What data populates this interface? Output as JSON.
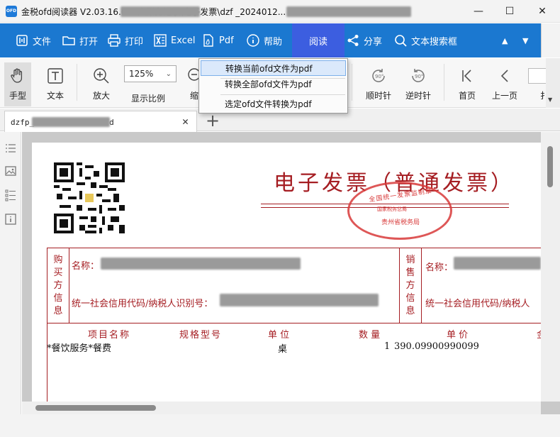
{
  "window": {
    "app_icon_text": "OFD",
    "title": "金税ofd阅读器 V2.03.16.06-                            人账务记录\\电子发票\\dzf                              _2024012...",
    "minimize": "—",
    "maximize": "☐",
    "close": "✕"
  },
  "toolbar": {
    "file": "文件",
    "open": "打开",
    "print": "打印",
    "excel": "Excel",
    "pdf": "Pdf",
    "help": "帮助",
    "read": "阅读",
    "share": "分享",
    "search": "文本搜索框",
    "up_arrow": "▲",
    "down_arrow": "▼"
  },
  "toolbar2": {
    "hand": "手型",
    "text": "文本",
    "zoom_in": "放大",
    "zoom_value": "125%",
    "zoom_label": "显示比例",
    "zoom_out": "缩",
    "rotate_cw": "顺时针",
    "rotate_ccw": "逆时针",
    "first_page": "首页",
    "prev_page": "上一页",
    "clipped_label": "扌"
  },
  "pdf_menu": {
    "items": [
      "转换当前ofd文件为pdf",
      "转换全部ofd文件为pdf",
      "选定ofd文件转换为pdf"
    ]
  },
  "doc_tab": {
    "name": "dzfp_                240129104546.ofd",
    "close": "✕",
    "new_tab": "+"
  },
  "invoice": {
    "title": "电子发票（普通发票）",
    "seal_top": "全国统一发票监制章",
    "seal_mid": "国家税务总局",
    "seal_bottom": "贵州省税务局",
    "buyer_label": "购买方信息",
    "seller_label": "销售方信息",
    "name_label": "名称：",
    "tax_id_label": "统一社会信用代码/纳税人识别号：",
    "seller_tax_id_label": "统一社会信用代码/纳税人",
    "col_item": "项目名称",
    "col_spec": "规格型号",
    "col_unit": "单  位",
    "col_qty": "数  量",
    "col_price": "单  价",
    "col_amount": "金",
    "row_item": "*餐饮服务*餐费",
    "row_unit": "桌",
    "row_qty": "1",
    "row_price": "390.09900990099"
  },
  "colors": {
    "toolbar_blue": "#1b78d0",
    "active_tab": "#3c5ee0",
    "invoice_red": "#a51d22",
    "seal_red": "#d83a3a"
  }
}
